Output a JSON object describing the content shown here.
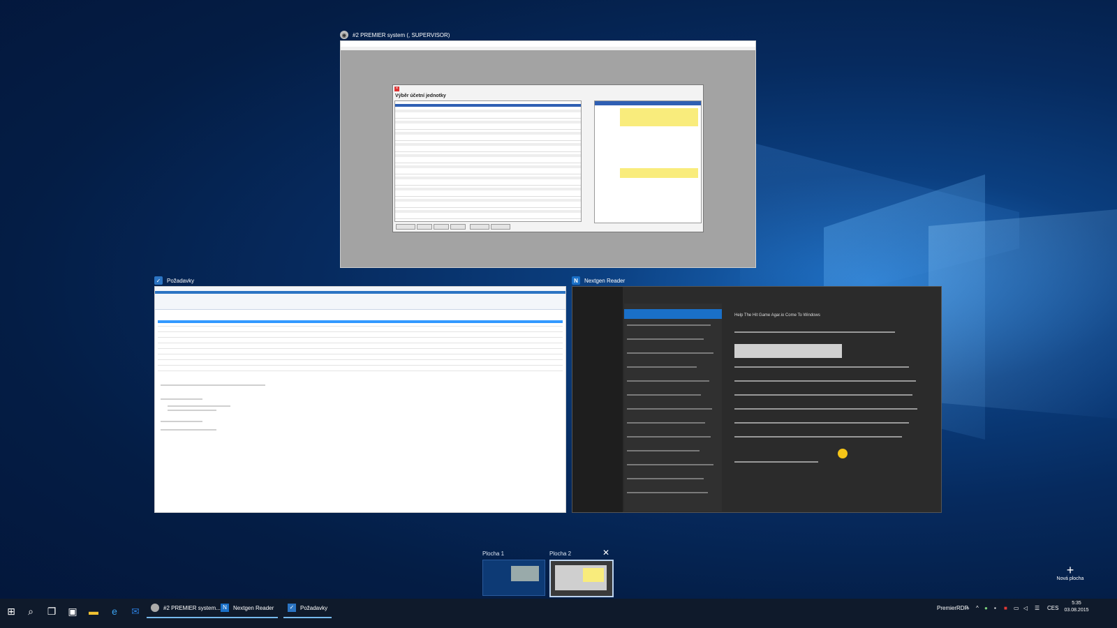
{
  "windows": [
    {
      "title": "#2 PREMIER system (, SUPERVISOR)",
      "dialog_title": "Výběr účetní jednotky"
    },
    {
      "title": "Požadavky"
    },
    {
      "title": "Nextgen Reader",
      "article_title": "Help The Hit Game Agar.io Come To Windows"
    }
  ],
  "desktops": [
    {
      "label": "Plocha 1",
      "active": false
    },
    {
      "label": "Plocha 2",
      "active": true
    }
  ],
  "new_desktop_label": "Nová plocha",
  "taskbar": {
    "apps": [
      {
        "label": "#2 PREMIER system...",
        "icon": "premier-icon"
      },
      {
        "label": "Nextgen Reader",
        "icon": "nextgen-icon"
      },
      {
        "label": "Požadavky",
        "icon": "pozadavky-icon"
      }
    ],
    "tray_label": "PremierRDP",
    "language": "CES",
    "time": "5:35",
    "date": "03.08.2015"
  },
  "colors": {
    "accent": "#76b9ed",
    "selected": "#1a70c8"
  }
}
